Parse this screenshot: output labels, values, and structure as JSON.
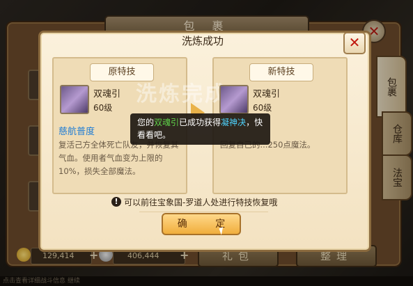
{
  "bag": {
    "title": "包 裹",
    "close_label": "✕",
    "tabs": [
      "包裹",
      "仓库",
      "法宝"
    ],
    "currency": [
      {
        "icon": "gold-coin-icon",
        "value": "129,414"
      },
      {
        "icon": "silver-coin-icon",
        "value": "406,444"
      }
    ],
    "buttons": {
      "gift": "礼包",
      "sort": "整理"
    },
    "plus": "+",
    "bottom_text": "点击查看详细战斗信息 继续"
  },
  "dialog": {
    "title": "洗炼成功",
    "close_label": "✕",
    "left": {
      "header": "原特技",
      "skill_name": "双魂引",
      "level": "60级",
      "special_title": "慈航普度",
      "description": "复活己方全体死亡队友，并恢复其气血。使用者气血变为上限的10%，损失全部魔法。"
    },
    "right": {
      "header": "新特技",
      "skill_name": "双魂引",
      "level": "60级",
      "description": "回复自己的...250点魔法。"
    },
    "watermark": "洗炼完成",
    "hint": "可以前往宝象国-罗道人处进行特技恢复哦",
    "confirm": "确 定"
  },
  "toast": {
    "prefix": "您的",
    "item": "双魂引",
    "middle": "已成功获得",
    "skill": "凝神决",
    "suffix": "，快看看吧。"
  },
  "colors": {
    "dialog_bg": "#f6e7c8",
    "highlight_blue": "#1f7cd4",
    "toast_green": "#5fd24a",
    "toast_cyan": "#4fd4ff",
    "close_red": "#c0180e",
    "confirm_gold": "#f0ae3c"
  }
}
